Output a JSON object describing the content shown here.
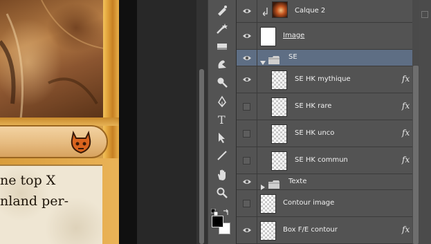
{
  "card": {
    "rules_line_1": "ne top X",
    "rules_line_2": "nland per-"
  },
  "tools": [
    {
      "name": "healing-brush-icon"
    },
    {
      "name": "magic-wand-icon"
    },
    {
      "name": "eraser-icon"
    },
    {
      "name": "smudge-icon"
    },
    {
      "name": "dodge-icon"
    },
    {
      "name": "pen-icon"
    },
    {
      "name": "type-icon",
      "glyph": "T"
    },
    {
      "name": "path-select-icon"
    },
    {
      "name": "line-icon"
    },
    {
      "name": "hand-icon"
    },
    {
      "name": "zoom-icon"
    }
  ],
  "colors": {
    "foreground": "#000000",
    "background": "#ffffff",
    "panel": "#535353",
    "selected_row": "#5e6e84"
  },
  "layers": [
    {
      "name": "Calque 2",
      "visible": true,
      "clipped": true,
      "thumb": "art"
    },
    {
      "name": "Image",
      "visible": true,
      "thumb": "white"
    },
    {
      "name": "SE",
      "visible": true,
      "group": true,
      "expanded": true,
      "selected": true
    },
    {
      "name": "SE HK mythique",
      "visible": true,
      "fx": "fx",
      "indent": true
    },
    {
      "name": "SE HK rare",
      "visible": false,
      "fx": "fx",
      "indent": true
    },
    {
      "name": "SE HK unco",
      "visible": false,
      "fx": "fx",
      "indent": true
    },
    {
      "name": "SE HK commun",
      "visible": false,
      "fx": "fx",
      "indent": true
    },
    {
      "name": "Texte",
      "visible": true,
      "group": true,
      "expanded": false
    },
    {
      "name": "Contour image",
      "visible": false,
      "thumb": "transparent"
    },
    {
      "name": "Box F/E contour",
      "visible": true,
      "fx": "fx",
      "thumb": "transparent"
    }
  ]
}
